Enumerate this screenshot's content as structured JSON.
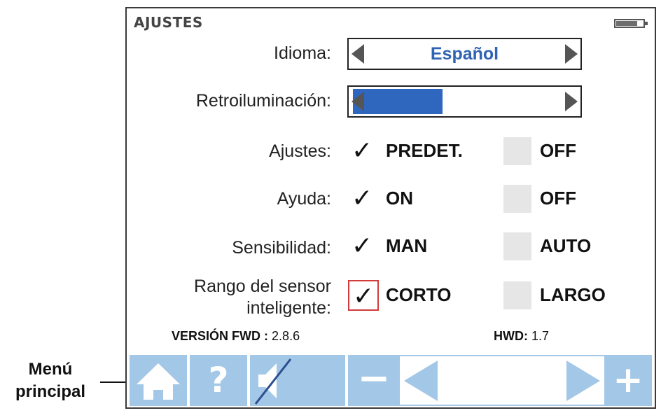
{
  "header": {
    "title": "AJUSTES",
    "battery_icon": "battery-icon"
  },
  "language": {
    "label": "Idioma:",
    "value": "Español"
  },
  "backlight": {
    "label": "Retroiluminación:",
    "level": 0.4
  },
  "settings": [
    {
      "label": "Ajustes:",
      "option_a": "PREDET.",
      "option_b": "OFF",
      "checked": "a"
    },
    {
      "label": "Ayuda:",
      "option_a": "ON",
      "option_b": "OFF",
      "checked": "a"
    },
    {
      "label": "Sensibilidad:",
      "option_a": "MAN",
      "option_b": "AUTO",
      "checked": "a"
    },
    {
      "label_line1": "Rango del sensor",
      "label_line2": "inteligente:",
      "option_a": "CORTO",
      "option_b": "LARGO",
      "checked": "a"
    }
  ],
  "version": {
    "fwd_label": "VERSIÓN FWD",
    "fwd_sep": ":",
    "fwd_value": "2.8.6",
    "hwd_label": "HWD:",
    "hwd_value": "1.7"
  },
  "toolbar": {
    "icons": [
      "home-icon",
      "help-icon",
      "mute-icon",
      "minus-icon",
      "arrow-left-icon",
      "arrow-right-icon",
      "plus-icon"
    ],
    "help_glyph": "?",
    "minus_glyph": "−",
    "plus_glyph": "+"
  },
  "callout": {
    "line1": "Menú",
    "line2": "principal"
  },
  "colors": {
    "accent": "#2f63b3",
    "toolbar": "#a3c7e6",
    "focus": "#d23b3b"
  }
}
